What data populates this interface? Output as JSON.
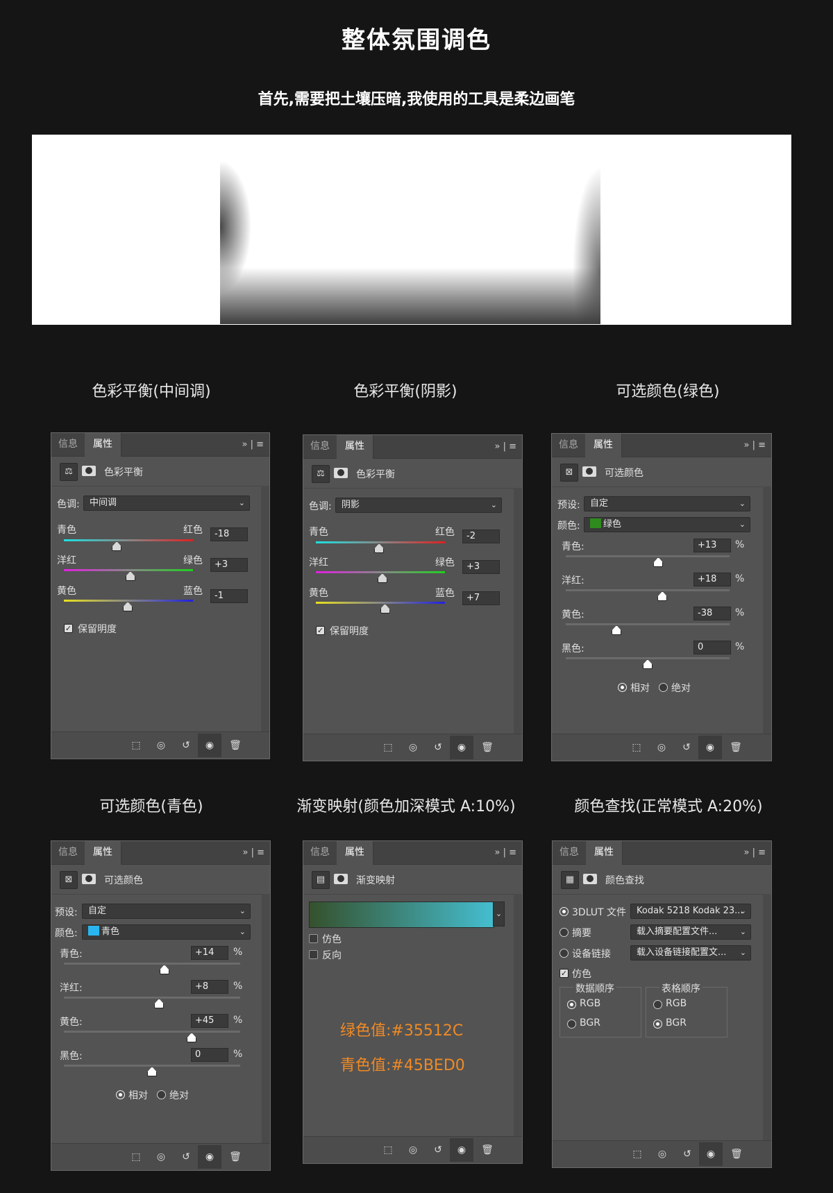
{
  "page": {
    "title": "整体氛围调色",
    "subtitle": "首先,需要把土壤压暗,我使用的工具是柔边画笔"
  },
  "common": {
    "tab_info": "信息",
    "tab_attr": "属性",
    "more": "»  |  ≡"
  },
  "sections": {
    "s1": "色彩平衡(中间调)",
    "s2": "色彩平衡(阴影)",
    "s3": "可选颜色(绿色)",
    "s4": "可选颜色(青色)",
    "s5": "渐变映射(颜色加深模式 A:10%)",
    "s6": "颜色查找(正常模式 A:20%)"
  },
  "p1": {
    "head": "色彩平衡",
    "tone_label": "色调:",
    "tone": "中间调",
    "rows": [
      {
        "left": "青色",
        "right": "红色",
        "value": "-18",
        "pos": 0.41
      },
      {
        "left": "洋红",
        "right": "绿色",
        "value": "+3",
        "pos": 0.515
      },
      {
        "left": "黄色",
        "right": "蓝色",
        "value": "-1",
        "pos": 0.495
      }
    ],
    "preserve": "保留明度"
  },
  "p2": {
    "head": "色彩平衡",
    "tone_label": "色调:",
    "tone": "阴影",
    "rows": [
      {
        "left": "青色",
        "right": "红色",
        "value": "-2",
        "pos": 0.49
      },
      {
        "left": "洋红",
        "right": "绿色",
        "value": "+3",
        "pos": 0.515
      },
      {
        "left": "黄色",
        "right": "蓝色",
        "value": "+7",
        "pos": 0.535
      }
    ],
    "preserve": "保留明度"
  },
  "p3": {
    "head": "可选颜色",
    "preset_label": "预设:",
    "preset": "自定",
    "color_label": "颜色:",
    "color": "绿色",
    "swatch": "#2e8b1e",
    "rows": [
      {
        "label": "青色:",
        "value": "+13",
        "pos": 0.565
      },
      {
        "label": "洋红:",
        "value": "+18",
        "pos": 0.59
      },
      {
        "label": "黄色:",
        "value": "-38",
        "pos": 0.31
      },
      {
        "label": "黑色:",
        "value": "0",
        "pos": 0.5
      }
    ],
    "pct": "%",
    "rel": "相对",
    "abs": "绝对"
  },
  "p4": {
    "head": "可选颜色",
    "preset_label": "预设:",
    "preset": "自定",
    "color_label": "颜色:",
    "color": "青色",
    "swatch": "#29b6f0",
    "rows": [
      {
        "label": "青色:",
        "value": "+14",
        "pos": 0.57
      },
      {
        "label": "洋红:",
        "value": "+8",
        "pos": 0.54
      },
      {
        "label": "黄色:",
        "value": "+45",
        "pos": 0.725
      },
      {
        "label": "黑色:",
        "value": "0",
        "pos": 0.5
      }
    ],
    "pct": "%",
    "rel": "相对",
    "abs": "绝对"
  },
  "p5": {
    "head": "渐变映射",
    "grad_from": "#35512C",
    "grad_to": "#45BED0",
    "dither": "仿色",
    "reverse": "反向",
    "green_note": "绿色值:#35512C",
    "cyan_note": "青色值:#45BED0"
  },
  "p6": {
    "head": "颜色查找",
    "r1": "3DLUT 文件",
    "r1_val": "Kodak 5218 Kodak 23...",
    "r2": "摘要",
    "r2_val": "载入摘要配置文件...",
    "r3": "设备链接",
    "r3_val": "载入设备链接配置文...",
    "dither": "仿色",
    "g1": "数据顺序",
    "g2": "表格顺序",
    "rgb": "RGB",
    "bgr": "BGR"
  }
}
